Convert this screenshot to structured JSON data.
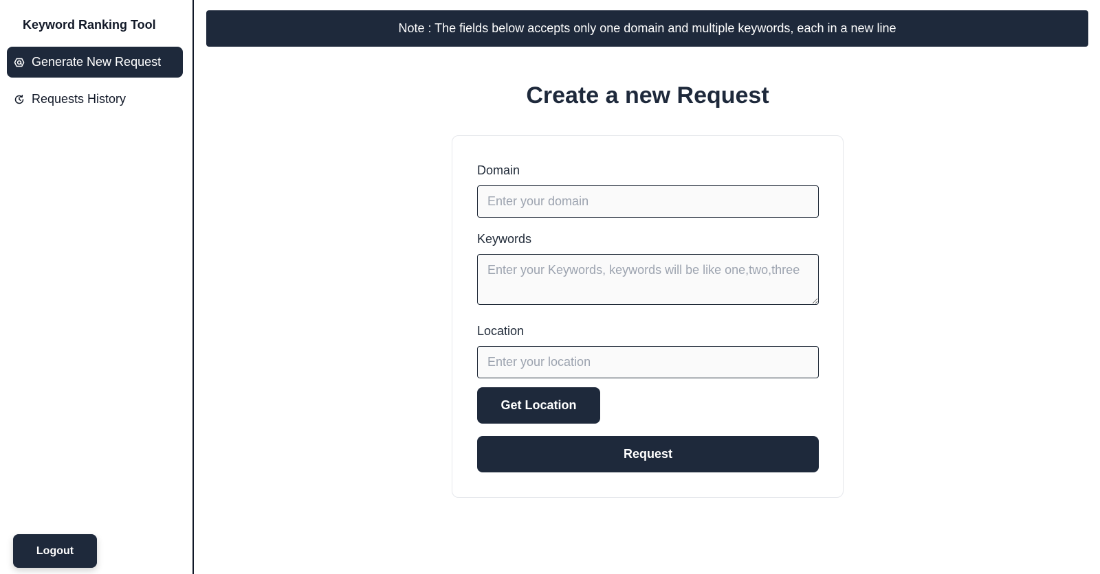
{
  "sidebar": {
    "brand": "Keyword Ranking Tool",
    "items": [
      {
        "label": "Generate New Request",
        "icon": "at-sign-icon",
        "active": true
      },
      {
        "label": "Requests History",
        "icon": "history-icon",
        "active": false
      }
    ],
    "logout_label": "Logout"
  },
  "main": {
    "note": "Note : The fields below accepts only one domain and multiple keywords, each in a new line",
    "title": "Create a new Request",
    "form": {
      "domain": {
        "label": "Domain",
        "placeholder": "Enter your domain",
        "value": ""
      },
      "keywords": {
        "label": "Keywords",
        "placeholder": "Enter your Keywords, keywords will be like one,two,three",
        "value": ""
      },
      "location": {
        "label": "Location",
        "placeholder": "Enter your location",
        "value": ""
      },
      "get_location_label": "Get Location",
      "submit_label": "Request"
    }
  },
  "colors": {
    "primary": "#1e293b",
    "text": "#1f2937",
    "placeholder": "#9ca3af",
    "card_border": "#e5e7eb"
  }
}
